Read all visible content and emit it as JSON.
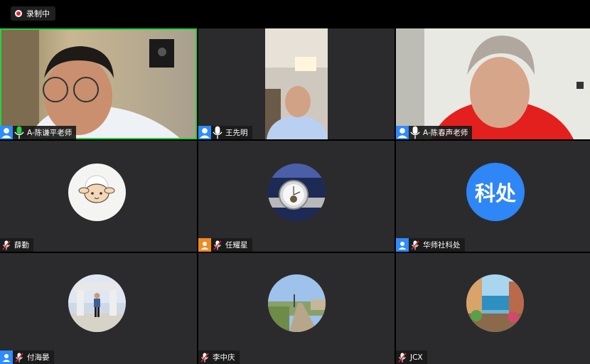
{
  "recording": {
    "label": "录制中",
    "icon": "record-icon"
  },
  "participants": [
    {
      "name": "A-陈谦平老师",
      "avatar_color": "#2d8cff",
      "mic": "on",
      "speaking": true
    },
    {
      "name": "王先明",
      "avatar_color": "#2d8cff",
      "mic": "on"
    },
    {
      "name": "A-陈春声老师",
      "avatar_color": "#2d8cff",
      "mic": "on"
    },
    {
      "name": "薛勤",
      "mic": "muted"
    },
    {
      "name": "任耀星",
      "avatar_color": "#f08a24",
      "mic": "muted"
    },
    {
      "name": "华师社科处",
      "avatar_color": "#2d8cff",
      "mic": "muted",
      "avatar_text": "科处"
    },
    {
      "name": "付海晏",
      "avatar_color": "#2d8cff",
      "mic": "muted"
    },
    {
      "name": "李中庆",
      "mic": "muted"
    },
    {
      "name": "JCX",
      "mic": "muted"
    }
  ],
  "colors": {
    "active_border": "#26d23c",
    "tile_bg": "#2b2b2d",
    "muted_mic": "#e5232b",
    "kechu_bg": "#2f86f6"
  }
}
